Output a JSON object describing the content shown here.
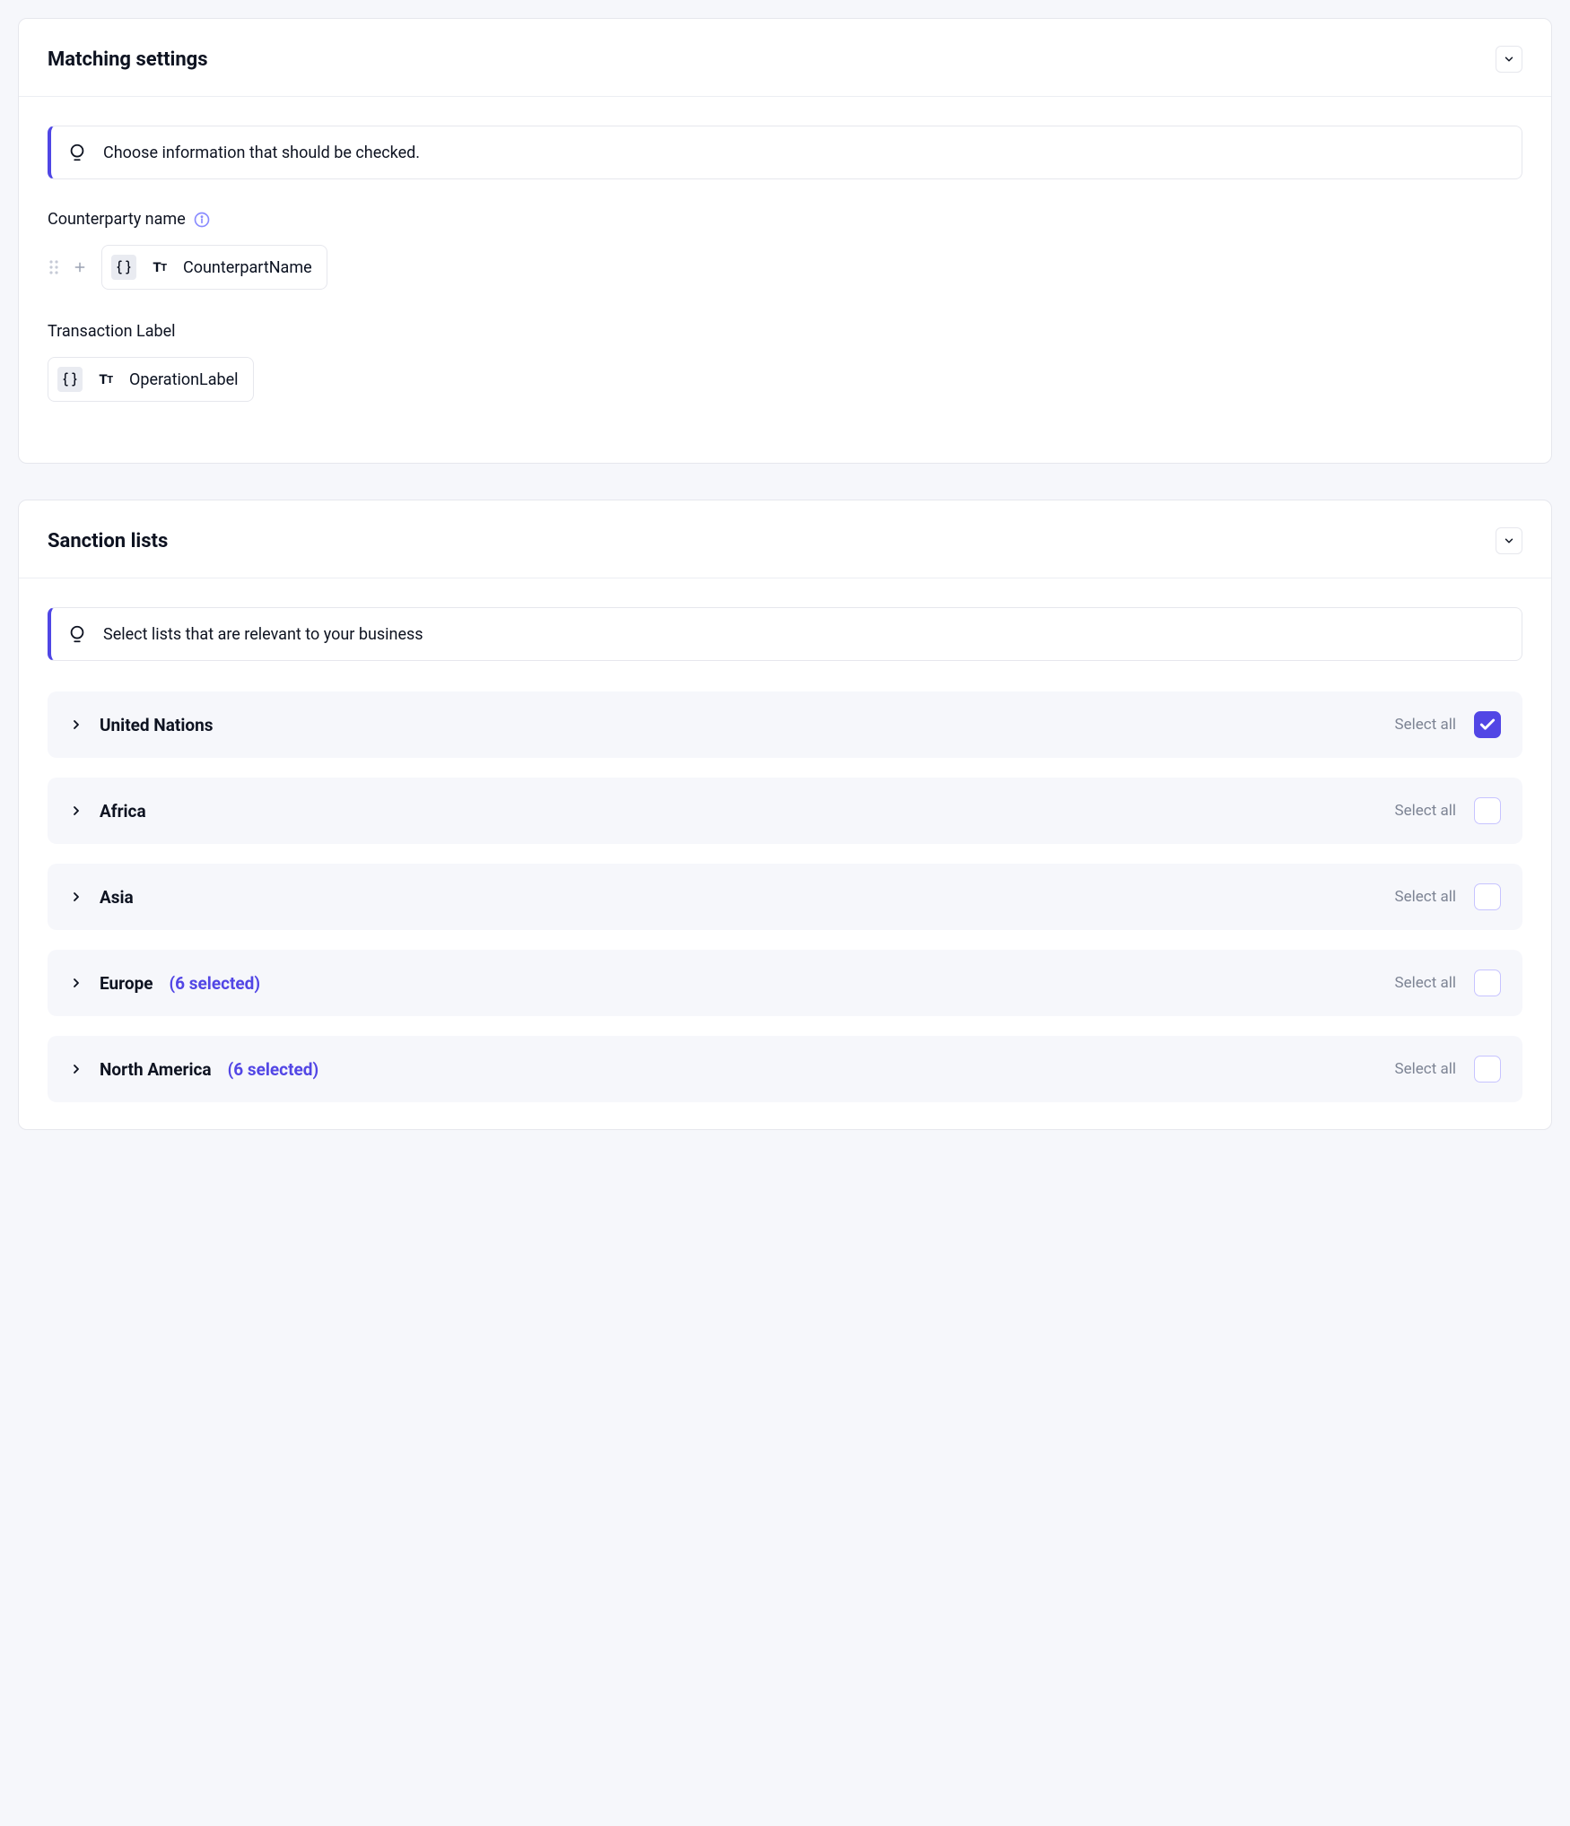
{
  "matching": {
    "title": "Matching settings",
    "callout": "Choose information that should be checked.",
    "fields": [
      {
        "label": "Counterparty name",
        "info": true,
        "draggable": true,
        "chip": "CounterpartName"
      },
      {
        "label": "Transaction Label",
        "info": false,
        "draggable": false,
        "chip": "OperationLabel"
      }
    ]
  },
  "sanctions": {
    "title": "Sanction lists",
    "callout": "Select lists that are relevant to your business",
    "selectAllLabel": "Select all",
    "groups": [
      {
        "name": "United Nations",
        "selectedCount": null,
        "selectAllChecked": true
      },
      {
        "name": "Africa",
        "selectedCount": null,
        "selectAllChecked": false
      },
      {
        "name": "Asia",
        "selectedCount": null,
        "selectAllChecked": false
      },
      {
        "name": "Europe",
        "selectedCount": 6,
        "selectAllChecked": false
      },
      {
        "name": "North America",
        "selectedCount": 6,
        "selectAllChecked": false
      }
    ]
  },
  "colors": {
    "accent": "#5246e5",
    "text": "#0e1321",
    "muted": "#7d8494",
    "border": "#e6e7ed",
    "panel": "#f6f7fb"
  }
}
